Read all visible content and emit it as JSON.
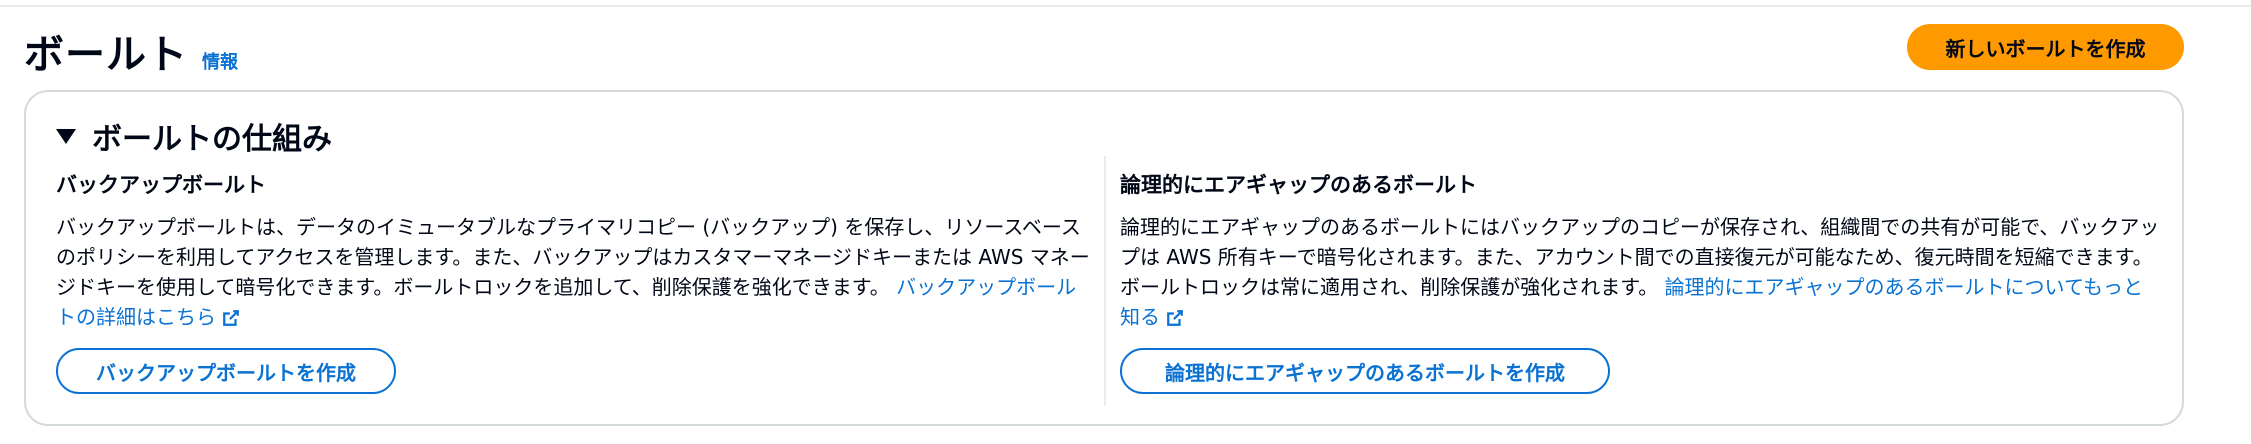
{
  "header": {
    "title": "ボールト",
    "info_link": "情報",
    "create_button": "新しいボールトを作成"
  },
  "panel": {
    "title": "ボールトの仕組み",
    "left": {
      "heading": "バックアップボールト",
      "body": "バックアップボールトは、データのイミュータブルなプライマリコピー (バックアップ) を保存し、リソースベースのポリシーを利用してアクセスを管理します。また、バックアップはカスタマーマネージドキーまたは AWS マネージドキーを使用して暗号化できます。ボールトロックを追加して、削除保護を強化できます。",
      "link": "バックアップボールトの詳細はこちら",
      "button": "バックアップボールトを作成"
    },
    "right": {
      "heading": "論理的にエアギャップのあるボールト",
      "body": "論理的にエアギャップのあるボールトにはバックアップのコピーが保存され、組織間での共有が可能で、バックアップは AWS 所有キーで暗号化されます。また、アカウント間での直接復元が可能なため、復元時間を短縮できます。ボールトロックは常に適用され、削除保護が強化されます。",
      "link": "論理的にエアギャップのあるボールトについてもっと知る",
      "button": "論理的にエアギャップのあるボールトを作成"
    }
  },
  "colors": {
    "accent": "#0972d3",
    "primary_button": "#ff9900",
    "text": "#000716",
    "border": "#d5dbdb"
  },
  "icons": [
    "caret-down-icon",
    "external-link-icon"
  ]
}
